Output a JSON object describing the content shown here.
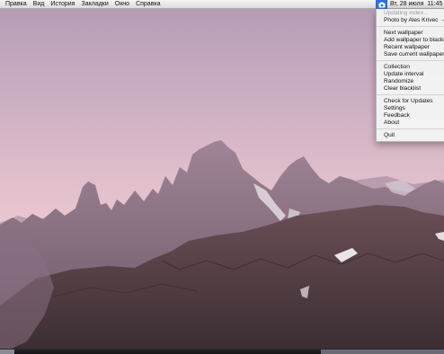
{
  "menubar": {
    "apple_symbol": "",
    "items": [
      "Правка",
      "Вид",
      "История",
      "Закладки",
      "Окно",
      "Справка"
    ],
    "clock_day": "Вт, 28 июля",
    "clock_time": "11:45",
    "status_icon": "camera-icon",
    "status_icon_color": "#2f6fd6"
  },
  "dropdown": {
    "updating": "Updating index...",
    "photo_by": "Photo by Ales Krivec →",
    "next_wallpaper": "Next wallpaper",
    "add_blacklist": "Add wallpaper to blacklist",
    "recent_wallpaper": "Recent wallpaper",
    "save_current": "Save current wallpaper",
    "collection": "Collection",
    "update_interval": "Update interval",
    "randomize": "Randomize",
    "clear_blacklist": "Clear blacklist",
    "check_updates": "Check for Updates",
    "settings": "Settings",
    "feedback": "Feedback",
    "about": "About",
    "quit": "Quit"
  },
  "colors": {
    "sky_top": "#c3a3b8",
    "sky_bottom": "#e8c6cf",
    "mountain": "#6c5a68",
    "menubar": "#e6e6e6"
  }
}
